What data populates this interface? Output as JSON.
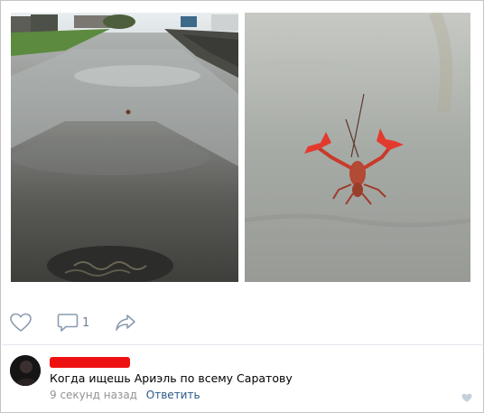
{
  "post": {
    "photos": [
      {
        "alt": "flooded-street-photo"
      },
      {
        "alt": "crayfish-in-water-photo"
      }
    ],
    "actions": {
      "like_icon": "heart-outline-icon",
      "comment_icon": "comment-bubble-icon",
      "comment_count": "1",
      "share_icon": "share-arrow-icon"
    }
  },
  "comment": {
    "author_name_redacted": true,
    "text": "Когда ищешь Ариэль по всему Саратову",
    "time": "9 секунд назад",
    "reply_label": "Ответить",
    "like_icon": "heart-filled-icon"
  },
  "colors": {
    "icon": "#8a9bb0",
    "link": "#2a5885",
    "meta": "#939393",
    "redaction": "#ee1111"
  }
}
